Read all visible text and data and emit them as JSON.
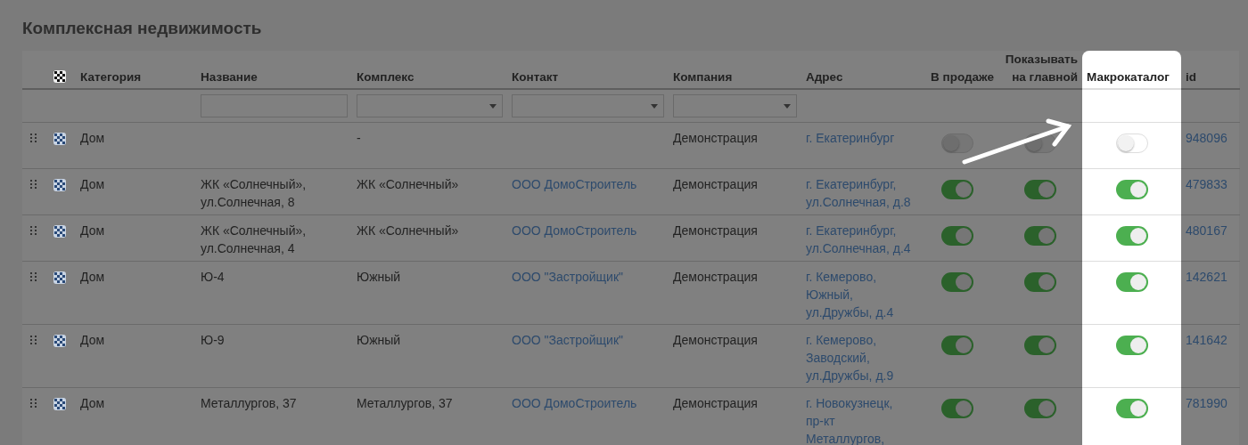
{
  "title": "Комплексная недвижимость",
  "columns": [
    {
      "label": "Категория",
      "highlighted": false
    },
    {
      "label": "Название",
      "highlighted": false
    },
    {
      "label": "Комплекс",
      "highlighted": false
    },
    {
      "label": "Контакт",
      "highlighted": false
    },
    {
      "label": "Компания",
      "highlighted": false
    },
    {
      "label": "Адрес",
      "highlighted": false
    },
    {
      "label": "В продаже",
      "highlighted": false
    },
    {
      "label": "Показывать на главной",
      "highlighted": false
    },
    {
      "label": "Макрокаталог",
      "highlighted": true
    },
    {
      "label": "id",
      "highlighted": false
    }
  ],
  "filters": [
    {
      "kind": "none"
    },
    {
      "kind": "text"
    },
    {
      "kind": "select"
    },
    {
      "kind": "select"
    },
    {
      "kind": "select"
    },
    {
      "kind": "none"
    },
    {
      "kind": "none"
    },
    {
      "kind": "none"
    },
    {
      "kind": "none"
    },
    {
      "kind": "none"
    }
  ],
  "rows": [
    {
      "category": "Дом",
      "name": "",
      "complex": "-",
      "contact": "",
      "company": "Демонстрация",
      "address": "г. Екатеринбург",
      "on_sale": false,
      "show_on_main": false,
      "macrocatalog": false,
      "id": "948096"
    },
    {
      "category": "Дом",
      "name": "ЖК «Солнечный», ул.Солнечная, 8",
      "complex": "ЖК «Солнечный»",
      "contact": "ООО ДомоСтроитель",
      "company": "Демонстрация",
      "address": "г. Екатеринбург, ул.Солнечная, д.8",
      "on_sale": true,
      "show_on_main": true,
      "macrocatalog": true,
      "id": "479833"
    },
    {
      "category": "Дом",
      "name": "ЖК «Солнечный», ул.Солнечная, 4",
      "complex": "ЖК «Солнечный»",
      "contact": "ООО ДомоСтроитель",
      "company": "Демонстрация",
      "address": "г. Екатеринбург, ул.Солнечная, д.4",
      "on_sale": true,
      "show_on_main": true,
      "macrocatalog": true,
      "id": "480167"
    },
    {
      "category": "Дом",
      "name": "Ю-4",
      "complex": "Южный",
      "contact": "ООО \"Застройщик\"",
      "company": "Демонстрация",
      "address": "г. Кемерово, Южный, ул.Дружбы, д.4",
      "on_sale": true,
      "show_on_main": true,
      "macrocatalog": true,
      "id": "142621"
    },
    {
      "category": "Дом",
      "name": "Ю-9",
      "complex": "Южный",
      "contact": "ООО \"Застройщик\"",
      "company": "Демонстрация",
      "address": "г. Кемерово, Заводский, ул.Дружбы, д.9",
      "on_sale": true,
      "show_on_main": true,
      "macrocatalog": true,
      "id": "141642"
    },
    {
      "category": "Дом",
      "name": "Металлургов, 37",
      "complex": "Металлургов, 37",
      "contact": "ООО ДомоСтроитель",
      "company": "Демонстрация",
      "address": "г. Новокузнецк, пр-кт Металлургов,",
      "on_sale": true,
      "show_on_main": true,
      "macrocatalog": true,
      "id": "781990"
    }
  ]
}
